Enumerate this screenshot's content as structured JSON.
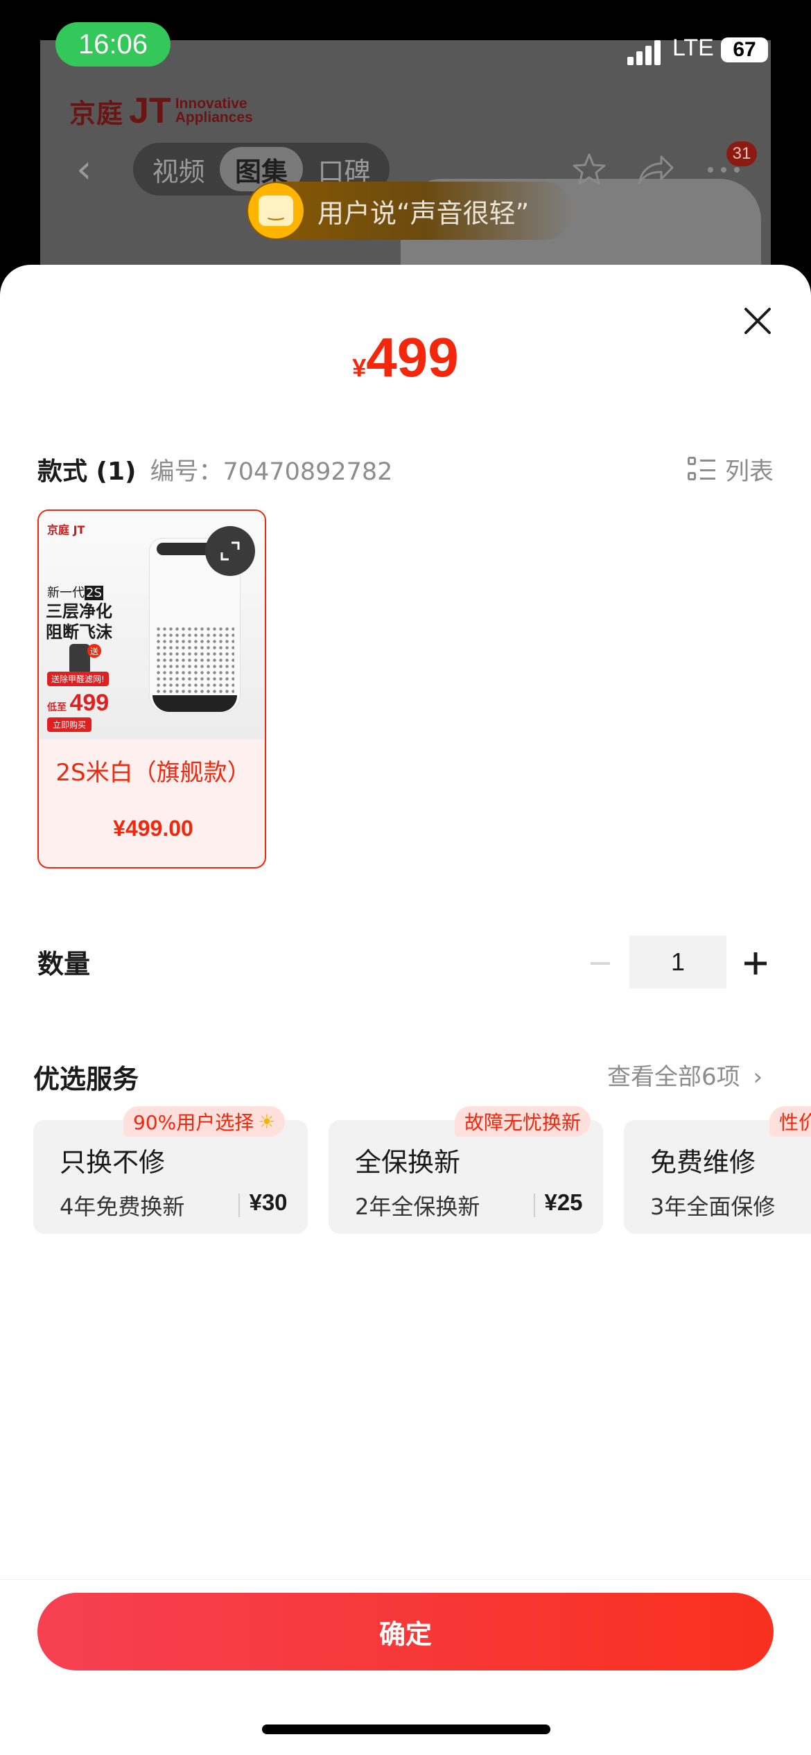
{
  "status_bar": {
    "time": "16:06",
    "network": "LTE",
    "battery": "67"
  },
  "background_page": {
    "brand_cn": "京庭",
    "brand_mark": "JT",
    "brand_en_line1": "Innovative",
    "brand_en_line2": "Appliances",
    "tabs": [
      "视频",
      "图集",
      "口碑"
    ],
    "active_tab": "图集",
    "message_count": "31",
    "review_hint": "用户说“声音很轻”"
  },
  "sheet": {
    "price_currency": "¥",
    "price_value": "499",
    "style_label": "款式 (1)",
    "item_code": "编号：70470892782",
    "list_view_label": "列表",
    "variant": {
      "name": "2S米白（旗舰款）",
      "price": "¥499.00",
      "image": {
        "brand_cn": "京庭",
        "brand_mark": "JT",
        "line1": "新一代",
        "line1_tag": "2S",
        "line2": "三层净化",
        "line3": "阻断飞沫",
        "gift_badge": "送",
        "promo_tag": "送除甲醛滤网!",
        "low_label": "低至",
        "low_price": "499",
        "buy_button": "立即购买"
      }
    },
    "quantity_label": "数量",
    "quantity_value": "1",
    "services_title": "优选服务",
    "services_view_all": "查看全部6项",
    "services": [
      {
        "tag": "90%用户选择",
        "name": "只换不修",
        "desc": "4年免费换新",
        "price": "¥30"
      },
      {
        "tag": "故障无忧换新",
        "name": "全保换新",
        "desc": "2年全保换新",
        "price": "¥25"
      },
      {
        "tag": "性价",
        "name": "免费维修",
        "desc": "3年全面保修",
        "price": ""
      }
    ],
    "confirm_label": "确定"
  },
  "colors": {
    "accent": "#f2270c",
    "button_gradient_start": "#f64052",
    "button_gradient_end": "#f8301f",
    "selected_card_bg": "#fff0f0",
    "service_tag_bg": "#ffe0dc"
  }
}
